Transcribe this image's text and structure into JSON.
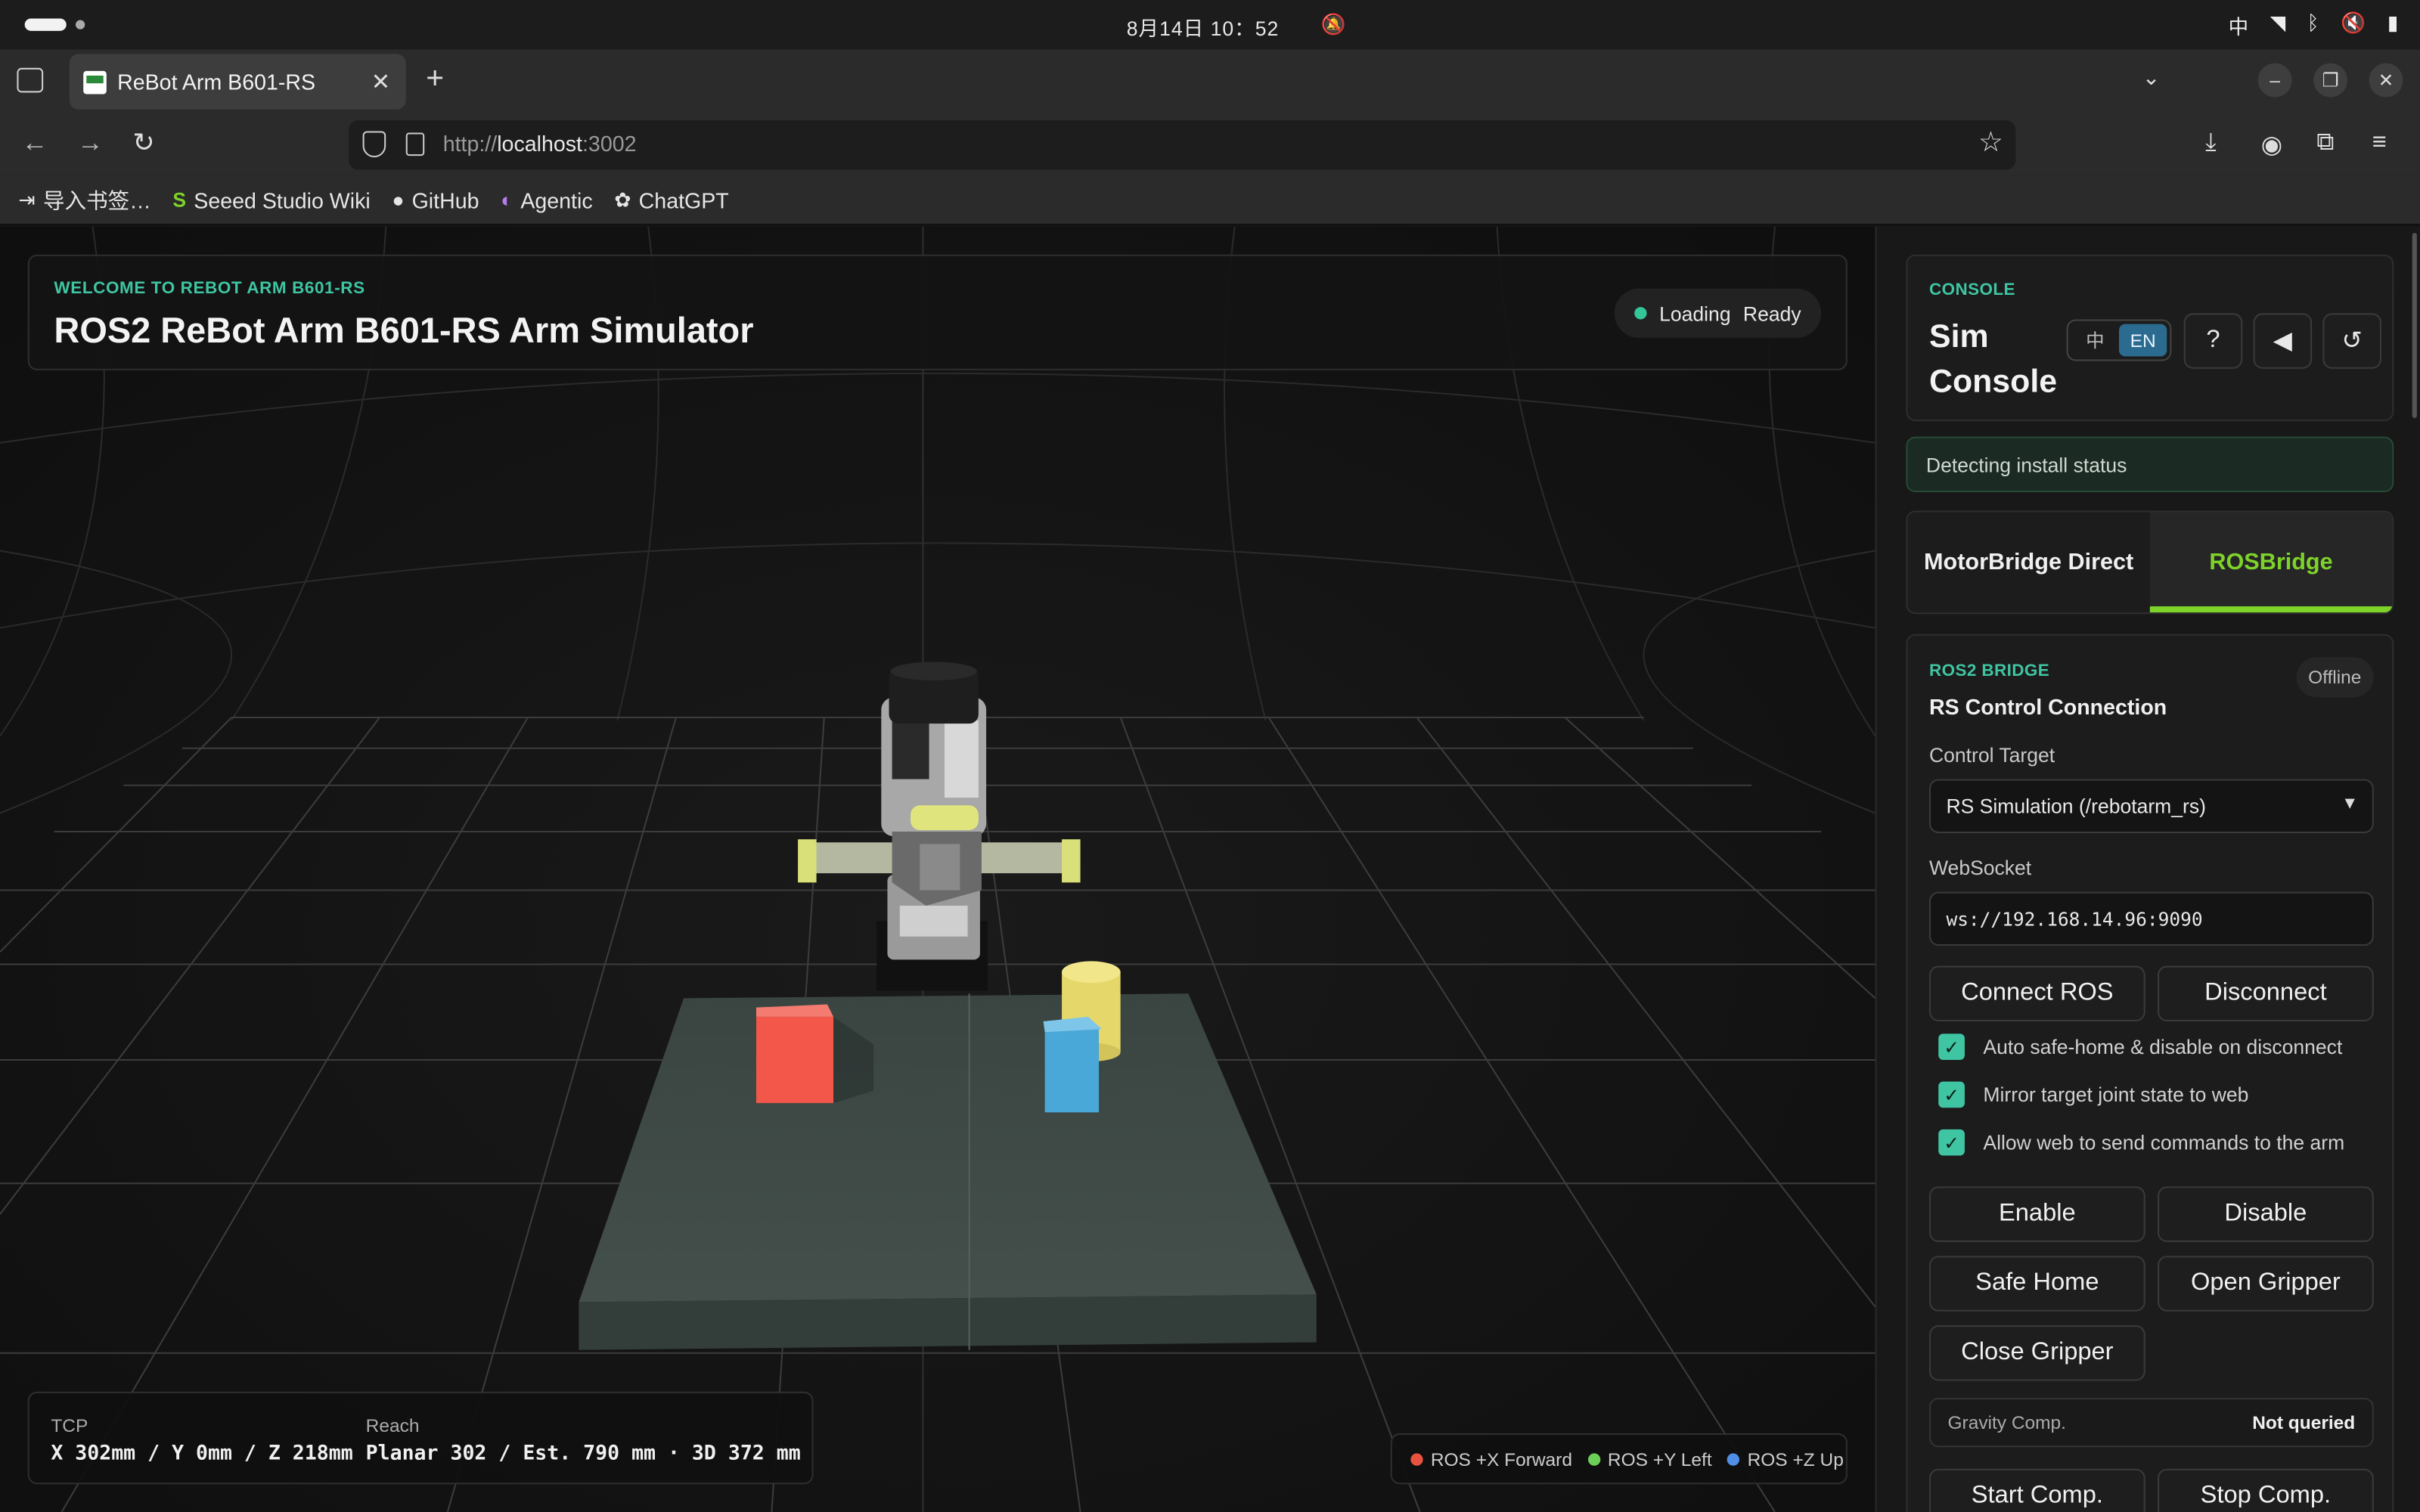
{
  "system": {
    "clock": "8月14日  10：52"
  },
  "browser": {
    "tab_title": "ReBot Arm B601-RS",
    "url_prefix": "http://",
    "url_host": "localhost",
    "url_port": ":3002",
    "bookmarks": [
      "导入书签…",
      "Seeed Studio Wiki",
      "GitHub",
      "Agentic",
      "ChatGPT"
    ]
  },
  "header": {
    "kicker": "WELCOME TO REBOT ARM B601-RS",
    "title": "ROS2 ReBot Arm B601-RS Arm Simulator",
    "status_loading": "Loading",
    "status_ready": "Ready"
  },
  "tcp": {
    "tcp_label": "TCP",
    "tcp_value": "X 302mm / Y 0mm / Z 218mm",
    "reach_label": "Reach",
    "reach_value": "Planar 302 / Est. 790 mm · 3D 372 mm"
  },
  "axes": [
    {
      "label": "ROS +X Forward",
      "color": "#e8533f"
    },
    {
      "label": "ROS +Y Left",
      "color": "#6ccf58"
    },
    {
      "label": "ROS +Z Up",
      "color": "#4f8fe8"
    }
  ],
  "console": {
    "kicker": "CONSOLE",
    "title": "Sim Console",
    "lang_zh": "中",
    "lang_en": "EN",
    "help": "?",
    "collapse": "◀",
    "reset": "↺"
  },
  "notice": "Detecting install status",
  "mode_tabs": [
    "MotorBridge Direct",
    "ROSBridge"
  ],
  "ros": {
    "kicker": "ROS2 BRIDGE",
    "title": "RS Control Connection",
    "status": "Offline",
    "target_label": "Control Target",
    "target_value": "RS Simulation (/rebotarm_rs)",
    "ws_label": "WebSocket",
    "ws_value": "ws://192.168.14.96:9090",
    "connect": "Connect ROS",
    "disconnect": "Disconnect",
    "checks": [
      "Auto safe-home & disable on disconnect",
      "Mirror target joint state to web",
      "Allow web to send commands to the arm"
    ],
    "enable": "Enable",
    "disable": "Disable",
    "safe_home": "Safe Home",
    "open_gripper": "Open Gripper",
    "close_gripper": "Close Gripper",
    "gravity_label": "Gravity Comp.",
    "gravity_value": "Not queried",
    "start_comp": "Start Comp.",
    "stop_comp": "Stop Comp."
  }
}
